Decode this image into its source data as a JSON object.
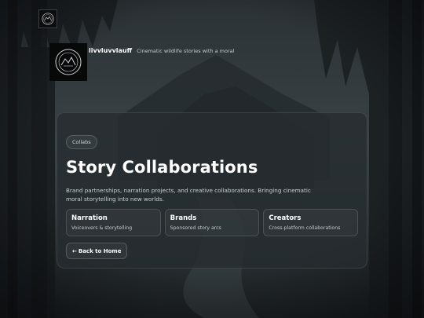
{
  "header": {
    "brand_name": "livvluvvlauff",
    "tagline": "Cinematic wildlife stories with a moral"
  },
  "card": {
    "chip": "Collabs",
    "title": "Story Collaborations",
    "description": "Brand partnerships, narration projects, and creative collaborations. Bringing cinematic moral storytelling into new worlds.",
    "tiles": [
      {
        "title": "Narration",
        "subtitle": "Voiceovers & storytelling"
      },
      {
        "title": "Brands",
        "subtitle": "Sponsored story arcs"
      },
      {
        "title": "Creators",
        "subtitle": "Cross-platform collaborations"
      }
    ],
    "back_arrow": "←",
    "back_label": "Back to Home"
  },
  "icons": {
    "top_logo": "circular-mountain-emblem-icon",
    "brand_logo": "circular-mountain-emblem-icon",
    "back": "arrow-left-icon"
  },
  "colors": {
    "background": "#2a3034",
    "card": "#262c30",
    "text": "#ffffff"
  }
}
